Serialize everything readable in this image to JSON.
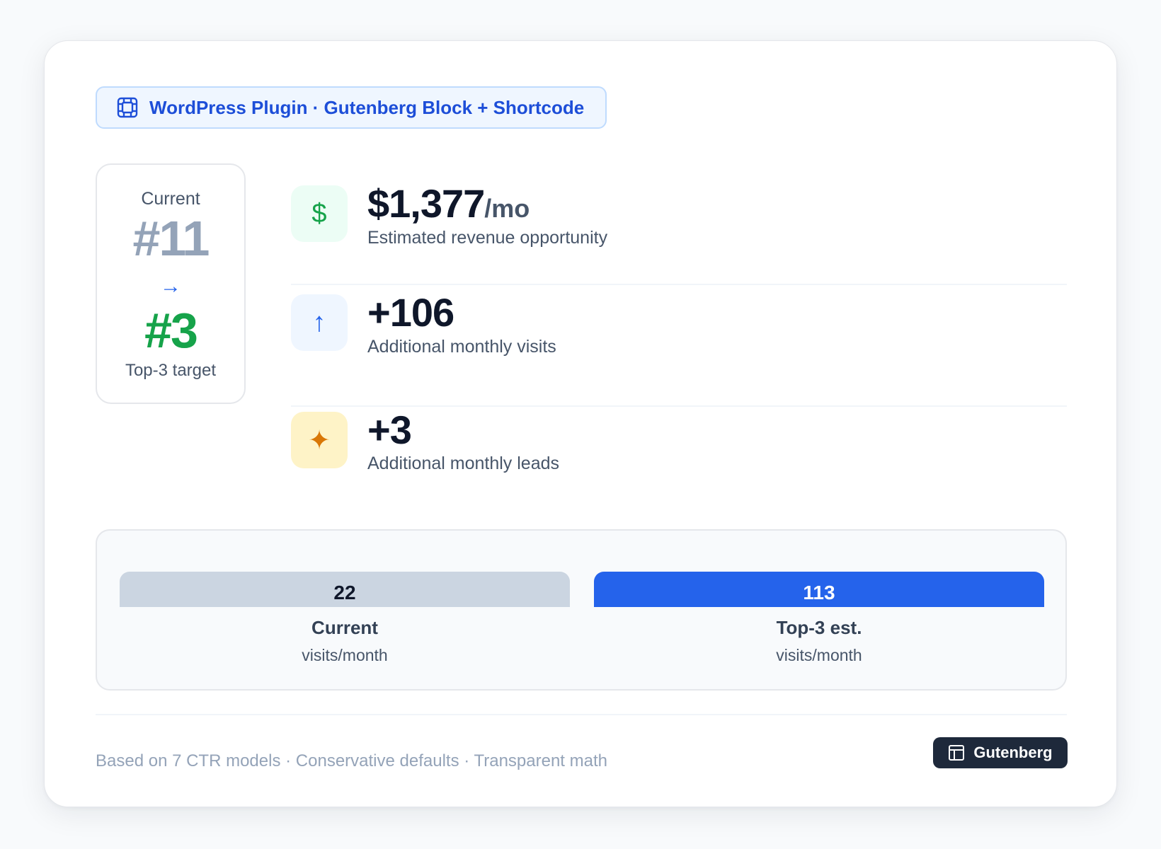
{
  "header_badge": {
    "icon": "film-block-icon",
    "label": "WordPress Plugin · Gutenberg Block + Shortcode",
    "color": "#1d4ed8"
  },
  "ranking": {
    "current_label": "Current",
    "current_rank": "#11",
    "arrow": "→",
    "target_rank": "#3",
    "target_label": "Top-3 target"
  },
  "metrics": [
    {
      "icon": "dollar-icon",
      "icon_glyph": "$",
      "value": "$1,377",
      "unit": "/mo",
      "label": "Estimated revenue opportunity",
      "accent": "#16a34a"
    },
    {
      "icon": "arrow-up-icon",
      "icon_glyph": "↑",
      "value": "+106",
      "unit": "",
      "label": "Additional monthly visits",
      "accent": "#2563eb"
    },
    {
      "icon": "sparkle-icon",
      "icon_glyph": "✦",
      "value": "+3",
      "unit": "",
      "label": "Additional monthly leads",
      "accent": "#d97706"
    }
  ],
  "visits_comparison": {
    "bars": [
      {
        "value": 22,
        "value_label": "22",
        "name": "Current",
        "unit": "visits/month",
        "color": "#cbd5e1"
      },
      {
        "value": 113,
        "value_label": "113",
        "name": "Top-3 est.",
        "unit": "visits/month",
        "color": "#2563eb"
      }
    ]
  },
  "footer": {
    "note": "Based on 7 CTR models · Conservative defaults · Transparent math",
    "pill_icon": "layout-icon",
    "pill_label": "Gutenberg"
  }
}
